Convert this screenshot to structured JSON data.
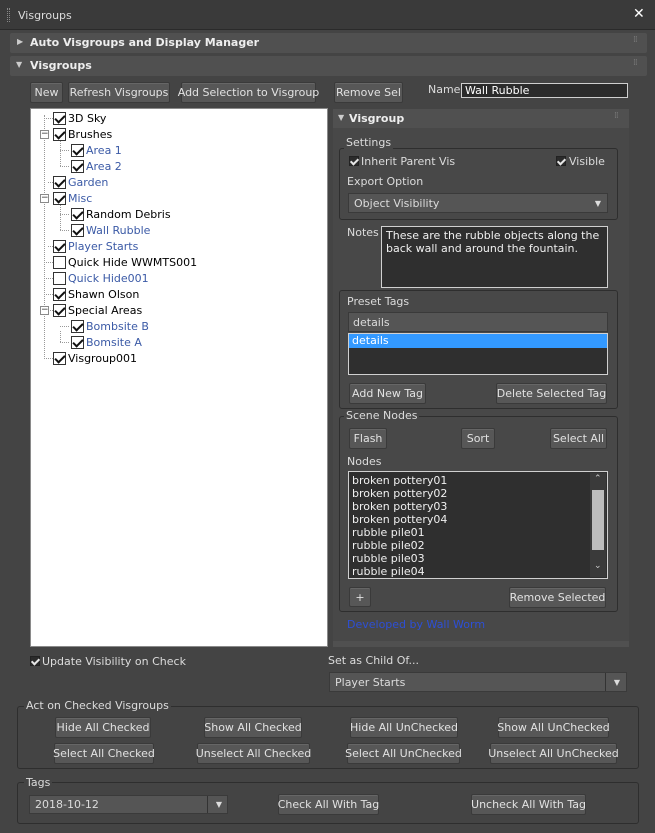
{
  "window": {
    "title": "Visgroups"
  },
  "rollouts": {
    "auto": "Auto Visgroups and Display Manager",
    "visgroups": "Visgroups"
  },
  "toolbar": {
    "new": "New",
    "refresh": "Refresh Visgroups",
    "add_selection": "Add Selection to Visgroup",
    "remove_sel": "Remove Sel",
    "name_label": "Name",
    "name_value": "Wall Rubble"
  },
  "tree": {
    "items": [
      {
        "label": "3D Sky"
      },
      {
        "label": "Brushes"
      },
      {
        "label": "Area 1"
      },
      {
        "label": "Area 2"
      },
      {
        "label": "Garden"
      },
      {
        "label": "Misc"
      },
      {
        "label": "Random Debris"
      },
      {
        "label": "Wall Rubble"
      },
      {
        "label": "Player Starts"
      },
      {
        "label": "Quick Hide WWMTS001"
      },
      {
        "label": "Quick Hide001"
      },
      {
        "label": "Shawn Olson"
      },
      {
        "label": "Special Areas"
      },
      {
        "label": "Bombsite B"
      },
      {
        "label": "Bomsite A"
      },
      {
        "label": "Visgroup001"
      }
    ]
  },
  "visgroup": {
    "title": "Visgroup",
    "settings_label": "Settings",
    "inherit": "Inherit Parent Vis",
    "visible": "Visible",
    "export_label": "Export Option",
    "export_value": "Object Visibility",
    "notes_label": "Notes",
    "notes_value": "These are the rubble objects along the back wall and around the fountain.",
    "preset_label": "Preset Tags",
    "preset_value": "details",
    "preset_items": [
      "details"
    ],
    "add_tag": "Add New Tag",
    "delete_tag": "Delete Selected Tag",
    "scene_nodes_label": "Scene Nodes",
    "flash": "Flash",
    "sort": "Sort",
    "select_all": "Select All",
    "nodes_label": "Nodes",
    "nodes": [
      "broken pottery01",
      "broken pottery02",
      "broken pottery03",
      "broken pottery04",
      "rubble pile01",
      "rubble pile02",
      "rubble pile03",
      "rubble pile04"
    ],
    "plus": "+",
    "remove_selected": "Remove Selected",
    "developed_by": "Developed by Wall Worm"
  },
  "bottom": {
    "update_vis": "Update Visibility on Check",
    "child_label": "Set as Child Of...",
    "child_value": "Player Starts",
    "act_label": "Act on Checked Visgroups",
    "hide_checked": "Hide All Checked",
    "show_checked": "Show All Checked",
    "hide_unchecked": "Hide All UnChecked",
    "show_unchecked": "Show All UnChecked",
    "select_checked": "Select All Checked",
    "unselect_checked": "Unselect All Checked",
    "select_unchecked": "Select All UnChecked",
    "unselect_unchecked": "Unselect All UnChecked",
    "tags_label": "Tags",
    "tag_value": "2018-10-12",
    "check_tag": "Check All With Tag",
    "uncheck_tag": "Uncheck All With Tag"
  },
  "colors": {
    "bg": "#444444",
    "selection": "#3399ff",
    "link": "#2d4fd6",
    "tree_blue": "#3b5aa6"
  }
}
